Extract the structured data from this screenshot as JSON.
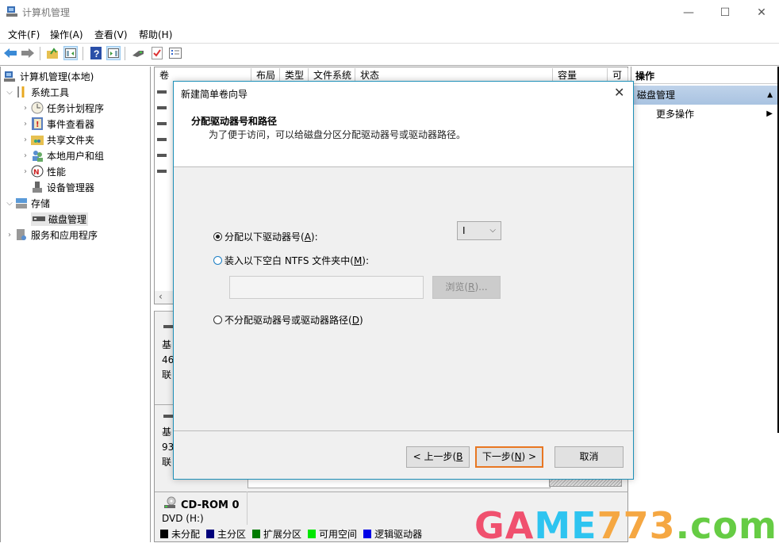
{
  "window": {
    "title": "计算机管理",
    "controls": {
      "minimize": "—",
      "maximize": "☐",
      "close": "✕"
    }
  },
  "menu": [
    "文件(F)",
    "操作(A)",
    "查看(V)",
    "帮助(H)"
  ],
  "toolbar": {
    "icons": [
      "back-arrow-icon",
      "forward-arrow-icon",
      "up-folder-icon",
      "show-hide-tree-icon",
      "help-icon",
      "show-hide-action-pane-icon",
      "disk-icon",
      "checklist-icon",
      "properties-icon"
    ]
  },
  "tree": {
    "root": "计算机管理(本地)",
    "items": [
      {
        "label": "系统工具",
        "level": 1,
        "expanded": true
      },
      {
        "label": "任务计划程序",
        "level": 2
      },
      {
        "label": "事件查看器",
        "level": 2
      },
      {
        "label": "共享文件夹",
        "level": 2
      },
      {
        "label": "本地用户和组",
        "level": 2
      },
      {
        "label": "性能",
        "level": 2
      },
      {
        "label": "设备管理器",
        "level": 2
      },
      {
        "label": "存储",
        "level": 1,
        "expanded": true
      },
      {
        "label": "磁盘管理",
        "level": 2,
        "selected": true
      },
      {
        "label": "服务和应用程序",
        "level": 1
      }
    ]
  },
  "volume_list": {
    "columns": [
      "卷",
      "布局",
      "类型",
      "文件系统",
      "状态",
      "容量",
      "可用"
    ]
  },
  "disk_area": {
    "disk1": {
      "line1": "基",
      "line2": "46",
      "line3": "联"
    },
    "disk2": {
      "line1": "基",
      "line2": "93",
      "line3": "联"
    },
    "cdrom": {
      "name": "CD-ROM 0",
      "type": "DVD (H:)"
    }
  },
  "legend": [
    {
      "label": "未分配",
      "color": "#000000"
    },
    {
      "label": "主分区",
      "color": "#00007b"
    },
    {
      "label": "扩展分区",
      "color": "#007b00"
    },
    {
      "label": "可用空间",
      "color": "#00e600"
    },
    {
      "label": "逻辑驱动器",
      "color": "#0000e6"
    }
  ],
  "actions": {
    "header": "操作",
    "selected": "磁盘管理",
    "more": "更多操作"
  },
  "dialog": {
    "title": "新建简单卷向导",
    "heading": "分配驱动器号和路径",
    "description": "为了便于访问，可以给磁盘分区分配驱动器号或驱动器路径。",
    "options": [
      {
        "label_pre": "分配以下驱动器号(",
        "key": "A",
        "label_post": "):",
        "checked": true
      },
      {
        "label_pre": "装入以下空白 NTFS 文件夹中(",
        "key": "M",
        "label_post": "):",
        "checked": false
      },
      {
        "label_pre": "不分配驱动器号或驱动器路径(",
        "key": "D",
        "label_post": ")",
        "checked": false
      }
    ],
    "drive_letter": "I",
    "folder_path": "",
    "browse": {
      "pre": "浏览(",
      "key": "R",
      "post": ")..."
    },
    "back": {
      "pre": "< 上一步(",
      "key": "B",
      "post": ""
    },
    "next": {
      "pre": "下一步(",
      "key": "N",
      "post": ") >"
    },
    "cancel": "取消"
  },
  "watermark": {
    "parts": [
      "GAME",
      "773",
      ".com"
    ],
    "colors": [
      "#f0506e",
      "#f5a742",
      "#66cc44"
    ],
    "game_mixed": [
      "GA",
      "ME"
    ],
    "game_colors": [
      "#f0506e",
      "#2ec4f0"
    ]
  }
}
